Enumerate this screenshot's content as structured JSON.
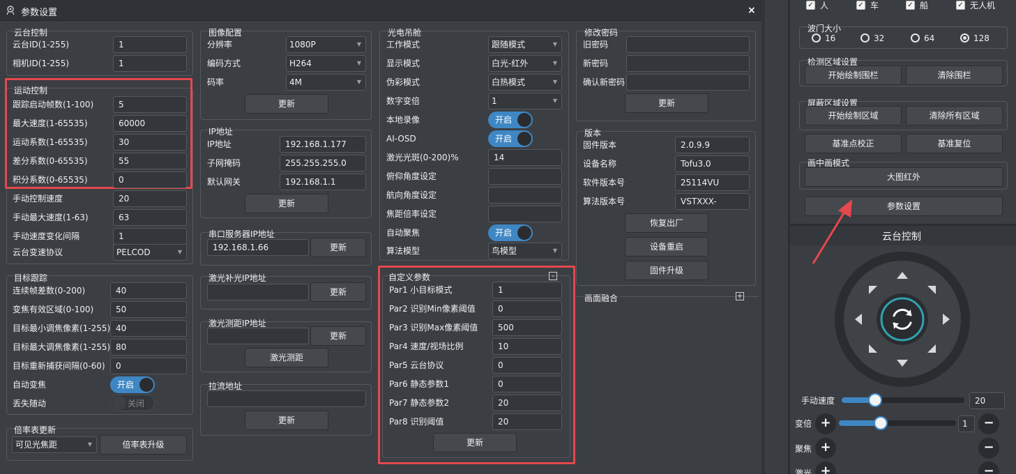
{
  "dialog": {
    "title": "参数设置",
    "close": "×"
  },
  "gimbal": {
    "title": "云台控制",
    "ptz_id_label": "云台ID(1-255)",
    "ptz_id": "1",
    "cam_id_label": "相机ID(1-255)",
    "cam_id": "1"
  },
  "motion": {
    "title": "运动控制",
    "rows": [
      {
        "label": "跟踪启动帧数(1-100)",
        "value": "5"
      },
      {
        "label": "最大速度(1-65535)",
        "value": "60000"
      },
      {
        "label": "运动系数(1-65535)",
        "value": "30"
      },
      {
        "label": "差分系数(0-65535)",
        "value": "55"
      },
      {
        "label": "积分系数(0-65535)",
        "value": "0"
      },
      {
        "label": "手动控制速度",
        "value": "20"
      },
      {
        "label": "手动最大速度(1-63)",
        "value": "63"
      },
      {
        "label": "手动速度变化间隔",
        "value": "1"
      }
    ],
    "protocol_label": "云台变速协议",
    "protocol": "PELCOD"
  },
  "tracking": {
    "title": "目标跟踪",
    "rows": [
      {
        "label": "连续帧差数(0-200)",
        "value": "40"
      },
      {
        "label": "变焦有效区域(0-100)",
        "value": "50"
      },
      {
        "label": "目标最小调焦像素(1-255)",
        "value": "40"
      },
      {
        "label": "目标最大调焦像素(1-255)",
        "value": "80"
      },
      {
        "label": "目标重新捕获间隔(0-60)",
        "value": "0"
      }
    ],
    "autozoom_label": "自动变焦",
    "autozoom": "开启",
    "follow_label": "丢失随动",
    "follow": "关闭"
  },
  "zoomtable": {
    "title": "倍率表更新",
    "combo": "可见光焦距",
    "button": "倍率表升级"
  },
  "image": {
    "title": "图像配置",
    "res_label": "分辨率",
    "res": "1080P",
    "codec_label": "编码方式",
    "codec": "H264",
    "bitrate_label": "码率",
    "bitrate": "4M",
    "update": "更新"
  },
  "ip": {
    "title": "IP地址",
    "ip_label": "IP地址",
    "ip": "192.168.1.177",
    "mask_label": "子网掩码",
    "mask": "255.255.255.0",
    "gw_label": "默认网关",
    "gw": "192.168.1.1",
    "update": "更新"
  },
  "serial": {
    "title": "串口服务器IP地址",
    "ip": "192.168.1.66",
    "update": "更新"
  },
  "laserfill": {
    "title": "激光补光IP地址",
    "ip": "",
    "update": "更新"
  },
  "laserrange": {
    "title": "激光测距IP地址",
    "ip": "",
    "update": "更新",
    "measure": "激光测距"
  },
  "stream": {
    "title": "拉流地址",
    "url": "",
    "update": "更新"
  },
  "pod": {
    "title": "光电吊舱",
    "workmode_label": "工作模式",
    "workmode": "跟随模式",
    "display_label": "显示模式",
    "display": "白光-红外",
    "pseudo_label": "伪彩模式",
    "pseudo": "白热模式",
    "dzoom_label": "数字变倍",
    "dzoom": "1",
    "record_label": "本地录像",
    "record": "开启",
    "osd_label": "AI-OSD",
    "osd": "开启",
    "laserspot_label": "激光光斑(0-200)%",
    "laserspot": "14",
    "pitch_label": "俯仰角度设定",
    "pitch": "",
    "yaw_label": "航向角度设定",
    "yaw": "",
    "focal_label": "焦距倍率设定",
    "focal": "",
    "autofocus_label": "自动聚焦",
    "autofocus": "开启",
    "algo_label": "算法模型",
    "algo": "鸟模型"
  },
  "custom": {
    "title": "自定义参数",
    "collapse": "-",
    "rows": [
      {
        "label": "Par1 小目标模式",
        "value": "1"
      },
      {
        "label": "Par2 识别Min像素阈值",
        "value": "0"
      },
      {
        "label": "Par3 识别Max像素阈值",
        "value": "500"
      },
      {
        "label": "Par4 速度/视场比例",
        "value": "10"
      },
      {
        "label": "Par5 云台协议",
        "value": "0"
      },
      {
        "label": "Par6 静态参数1",
        "value": "0"
      },
      {
        "label": "Par7 静态参数2",
        "value": "20"
      },
      {
        "label": "Par8 识别阈值",
        "value": "20"
      }
    ],
    "update": "更新"
  },
  "password": {
    "title": "修改密码",
    "old_label": "旧密码",
    "new_label": "新密码",
    "confirm_label": "确认新密码",
    "update": "更新"
  },
  "version": {
    "title": "版本",
    "rows": [
      {
        "label": "固件版本",
        "value": "2.0.9.9"
      },
      {
        "label": "设备名称",
        "value": "Tofu3.0"
      },
      {
        "label": "软件版本号",
        "value": "25114VU"
      },
      {
        "label": "算法版本号",
        "value": "VSTXXX-"
      }
    ],
    "reset": "恢复出厂",
    "reboot": "设备重启",
    "upgrade": "固件升级"
  },
  "fusion": {
    "title": "画面融合",
    "expand": "+"
  },
  "side": {
    "targets": [
      {
        "label": "人"
      },
      {
        "label": "车"
      },
      {
        "label": "船"
      },
      {
        "label": "无人机"
      }
    ],
    "gate": {
      "title": "波门大小",
      "options": [
        "16",
        "32",
        "64",
        "128"
      ],
      "selected": "128"
    },
    "detect": {
      "title": "检测区域设置",
      "draw": "开始绘制围栏",
      "clear": "清除围栏"
    },
    "mask": {
      "title": "屏蔽区域设置",
      "draw": "开始绘制区域",
      "clear": "清除所有区域"
    },
    "calib": "基准点校正",
    "reset": "基准复位",
    "pip": {
      "title": "画中画模式",
      "mode": "大图红外"
    },
    "params": "参数设置",
    "ptz_title": "云台控制",
    "speed_label": "手动速度",
    "speed": "20",
    "speed_fraction": 0.27,
    "zoom_label": "变倍",
    "zoom": "1",
    "zoom_fraction": 0.36,
    "focus_label": "聚焦",
    "laser_label": "激光"
  },
  "colors": {
    "accent": "#3f87c4",
    "highlight": "#e5484d"
  }
}
